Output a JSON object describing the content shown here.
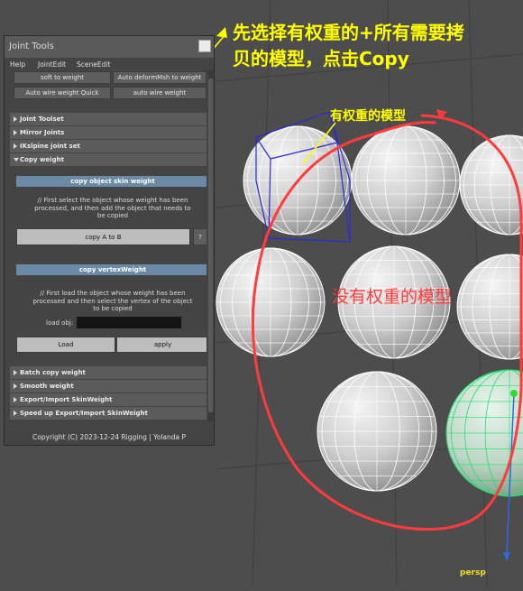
{
  "annotations": {
    "top_line1": "先选择有权重的+所有需要拷",
    "top_line2": "贝的模型，点击Copy",
    "weighted_label": "有权重的模型",
    "unweighted_label": "没有权重的模型"
  },
  "viewport": {
    "camera_label": "persp"
  },
  "window": {
    "title": "Joint Tools",
    "menu": [
      "Help",
      "JointEdit",
      "SceneEdit"
    ],
    "top_buttons": {
      "soft_to_weight": "soft to weight",
      "auto_deform": "Auto deformMsh to weight",
      "auto_wire_quick": "Auto wire weight Quick",
      "auto_wire": "auto wire weight"
    },
    "sections": {
      "joint_toolset": "Joint Toolset",
      "mirror_joints": "Mirror Joints",
      "ikspline": "IKslpine joint set",
      "copy_weight": "Copy weight",
      "batch_copy": "Batch copy weight",
      "smooth": "Smooth weight",
      "export_import": "Export/Import SkinWeight",
      "speed_up": "Speed up Export/Import SkinWeight"
    },
    "copy_object": {
      "header": "copy object skin weight",
      "desc1": "// First select the object whose weight has been",
      "desc2": "processed, and then add the object that needs to",
      "desc3": "be copied",
      "copy_btn": "copy A to B",
      "help_btn": "?"
    },
    "copy_vertex": {
      "header": "copy vertexWeight",
      "desc1": "// First load the object whose weight has been",
      "desc2": "processed and then select the vertex of the object",
      "desc3": "to be copied",
      "load_obj_label": "load obj:",
      "load_obj_value": "",
      "load_btn": "Load",
      "apply_btn": "apply"
    },
    "footer": "Copyright (C)  2023-12-24  Rigging  | Yolanda P"
  },
  "colors": {
    "annotation_yellow": "#ffff00",
    "annotation_red": "#ff3b3b",
    "section_band": "#6a8aa6",
    "selection_blue": "#2b2bd6",
    "selection_green": "#20e070"
  }
}
